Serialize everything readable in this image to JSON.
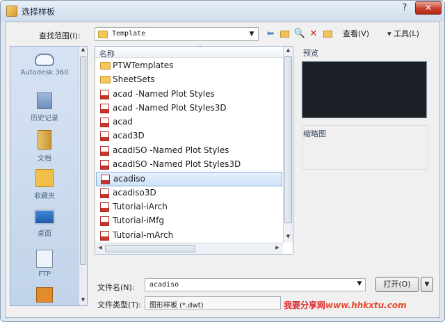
{
  "window": {
    "title": "选择样板",
    "help_glyph": "?",
    "close_glyph": "✕"
  },
  "toolbar": {
    "look_in_label": "查找范围(I):",
    "look_in_value": "Template",
    "views_label": "查看(V)",
    "tools_label": "▾ 工具(L)",
    "back_glyph": "⬅",
    "search_glyph": "🔍",
    "delete_glyph": "✕",
    "dropdown_glyph": "▼"
  },
  "places": [
    {
      "id": "autodesk360",
      "label": "Autodesk 360"
    },
    {
      "id": "history",
      "label": "历史记录"
    },
    {
      "id": "documents",
      "label": "文档"
    },
    {
      "id": "favorites",
      "label": "收藏夹"
    },
    {
      "id": "desktop",
      "label": "桌面"
    },
    {
      "id": "ftp",
      "label": "FTP"
    },
    {
      "id": "buzzsaw",
      "label": ""
    }
  ],
  "file_list": {
    "column_name": "名称",
    "sort_glyph": "^",
    "selected_index": 9,
    "items": [
      {
        "name": "PTWTemplates",
        "type": "folder"
      },
      {
        "name": "SheetSets",
        "type": "folder"
      },
      {
        "name": "acad -Named Plot Styles",
        "type": "dwt"
      },
      {
        "name": "acad -Named Plot Styles3D",
        "type": "dwt"
      },
      {
        "name": "acad",
        "type": "dwt"
      },
      {
        "name": "acad3D",
        "type": "dwt"
      },
      {
        "name": "acadISO -Named Plot Styles",
        "type": "dwt"
      },
      {
        "name": "acadISO -Named Plot Styles3D",
        "type": "dwt"
      },
      {
        "name": "acadiso",
        "type": "dwt"
      },
      {
        "name": "acadiso3D",
        "type": "dwt"
      },
      {
        "name": "Tutorial-iArch",
        "type": "dwt"
      },
      {
        "name": "Tutorial-iMfg",
        "type": "dwt"
      },
      {
        "name": "Tutorial-mArch",
        "type": "dwt"
      }
    ]
  },
  "preview": {
    "label": "预览",
    "thumbnail_label": "缩略图"
  },
  "bottom": {
    "filename_label": "文件名(N):",
    "filename_value": "acadiso",
    "filetype_label": "文件类型(T):",
    "filetype_value": "图形样板 (*.dwt)",
    "open_label": "打开(O)"
  },
  "watermark": {
    "text": "我要分享网",
    "site": "www.hhkxtu.com"
  },
  "colors": {
    "selection": "#cfe3f8",
    "preview_bg": "#1b1f26",
    "close_red": "#c8402c",
    "watermark": "#e0262b"
  }
}
